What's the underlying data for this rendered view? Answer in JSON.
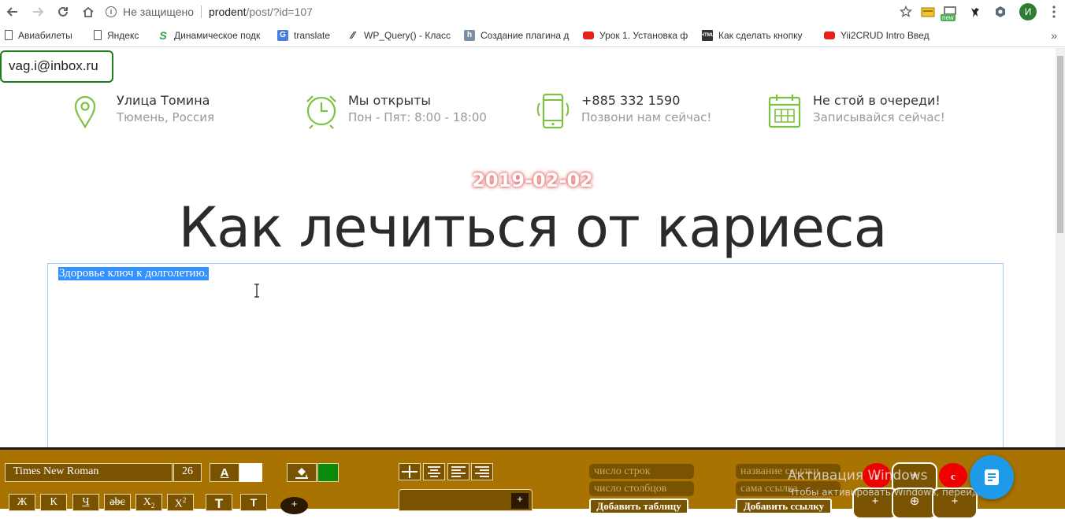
{
  "browser": {
    "security_label": "Не защищено",
    "url_host": "prodent",
    "url_path": "/post/?id=107",
    "bookmarks": [
      {
        "label": "Авиабилеты",
        "icon": "doc"
      },
      {
        "label": "Яндекс",
        "icon": "doc"
      },
      {
        "label": "Динамическое подк",
        "icon": "ss"
      },
      {
        "label": "translate",
        "icon": "gtr"
      },
      {
        "label": "WP_Query() - Класс",
        "icon": "wp"
      },
      {
        "label": "Создание плагина д",
        "icon": "hbox"
      },
      {
        "label": "Урок 1. Установка ф",
        "icon": "yt"
      },
      {
        "label": "Как сделать кнопку",
        "icon": "ht"
      },
      {
        "label": "Yii2CRUD Intro Введ",
        "icon": "yt"
      }
    ],
    "profile_initial": "И",
    "new_badge": "new"
  },
  "page": {
    "user_email": "vag.i@inbox.ru",
    "info": [
      {
        "title": "Улица Томина",
        "subtitle": "Тюмень, Россия",
        "icon": "map-pin-icon"
      },
      {
        "title": "Мы открыты",
        "subtitle": "Пон - Пят: 8:00 - 18:00",
        "icon": "alarm-clock-icon"
      },
      {
        "title": "+885 332 1590",
        "subtitle": "Позвони нам сейчас!",
        "icon": "phone-icon"
      },
      {
        "title": "Не стой в очереди!",
        "subtitle": "Записывайся сейчас!",
        "icon": "calendar-icon"
      }
    ],
    "post_date": "2019-02-02",
    "post_title": "Как лечиться от кариеса",
    "editor_text": "Здоровье ключ к долголетию.",
    "accent_color": "#7cc142"
  },
  "toolbar": {
    "font_name": "Times New Roman",
    "font_size": "26",
    "text_color_label": "A",
    "format_buttons": [
      "Ж",
      "К",
      "Ч",
      "abc",
      "X",
      "X"
    ],
    "sub_mark": "2",
    "sup_mark": "2",
    "text_buttons": [
      "T",
      "T"
    ],
    "plus": "+",
    "table_rows_placeholder": "число строк",
    "table_cols_placeholder": "число столбцов",
    "add_table_label": "Добавить таблицу",
    "link_name_placeholder": "название ссылки",
    "link_url_placeholder": "сама ссылка",
    "add_link_label": "Добавить ссылку",
    "red_left_label": "r",
    "red_right_label": "c",
    "center_plus": "+",
    "bottom_left_plus": "+",
    "bottom_center_icon": "⊕",
    "bottom_right_plus": "+",
    "colors": {
      "background": "#a87300",
      "inner": "#7a5300",
      "text_fill": "#ffffff",
      "highlight": "#0a8a0a"
    }
  },
  "system": {
    "activation_title": "Активация Windows",
    "activation_sub": "Чтобы активировать Windows, перейдите в"
  }
}
